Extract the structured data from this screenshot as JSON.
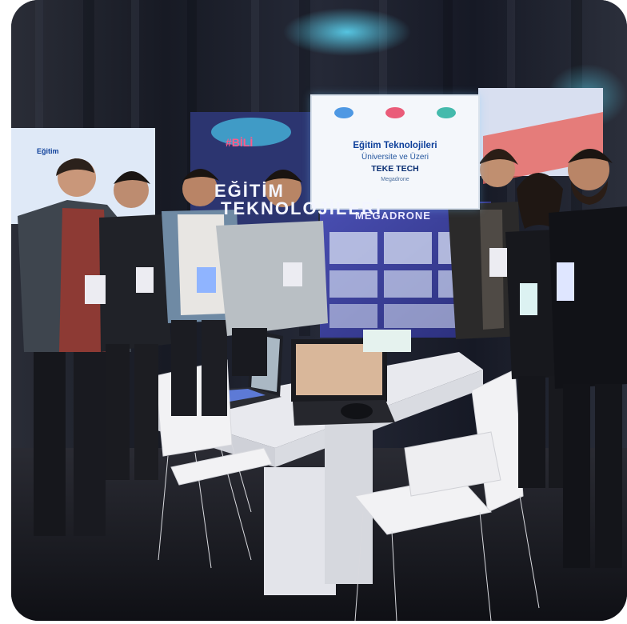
{
  "photo": {
    "sign": {
      "title": "Eğitim Teknolojileri",
      "subtitle": "Üniversite ve Üzeri",
      "team": "TEKE TECH",
      "project_small": "Megadrone"
    },
    "poster_title": "MEGADRONE",
    "backdrop_logo": "#BİLİ",
    "backdrop_word_1": "EĞİTİM",
    "backdrop_word_2": "TEKNOLOJİLERİ",
    "left_sign_fragment": "Eğitim"
  },
  "colors": {
    "curtain": "#1f2230",
    "table": "#e8e9ee",
    "poster": "#3b3f8f",
    "cyan_light": "#4bd7ff"
  }
}
